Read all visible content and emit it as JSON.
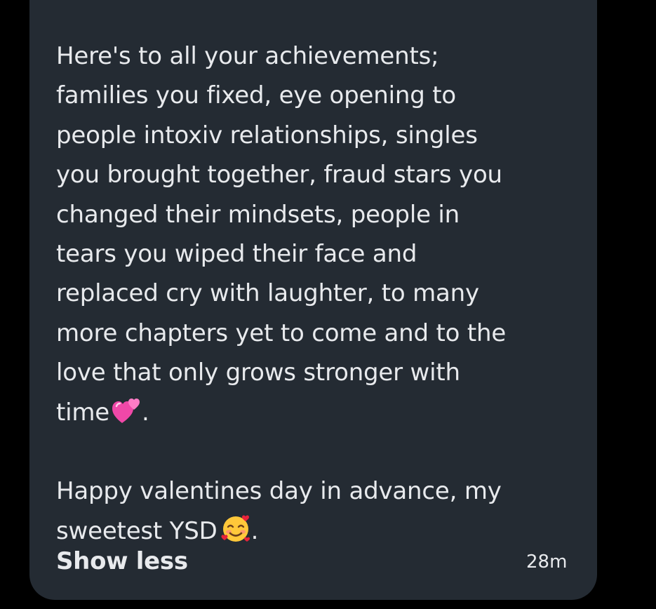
{
  "message": {
    "paragraph_1_lines": [
      "Here's to all your achievements;",
      "families you fixed, eye opening to",
      "people intoxiv relationships, singles",
      "you brought together, fraud stars you",
      "changed their mindsets, people in",
      "tears you wiped their face and",
      "replaced cry with laughter, to many",
      "more chapters yet to come and to the",
      "love that only grows stronger with"
    ],
    "paragraph_1_last_line_text": "time",
    "paragraph_1_last_line_icon": "two-hearts-emoji",
    "paragraph_1_last_line_suffix": ".",
    "paragraph_2_line_1": "Happy valentines day in advance, my",
    "paragraph_2_line_2_text": "sweetest YSD",
    "paragraph_2_line_2_icon": "smiling-face-with-hearts-emoji",
    "paragraph_2_line_2_suffix": "."
  },
  "footer": {
    "show_less_label": "Show less",
    "timestamp": "28m"
  },
  "colors": {
    "background": "#000000",
    "bubble": "#242b33",
    "text": "#e8eaed"
  }
}
